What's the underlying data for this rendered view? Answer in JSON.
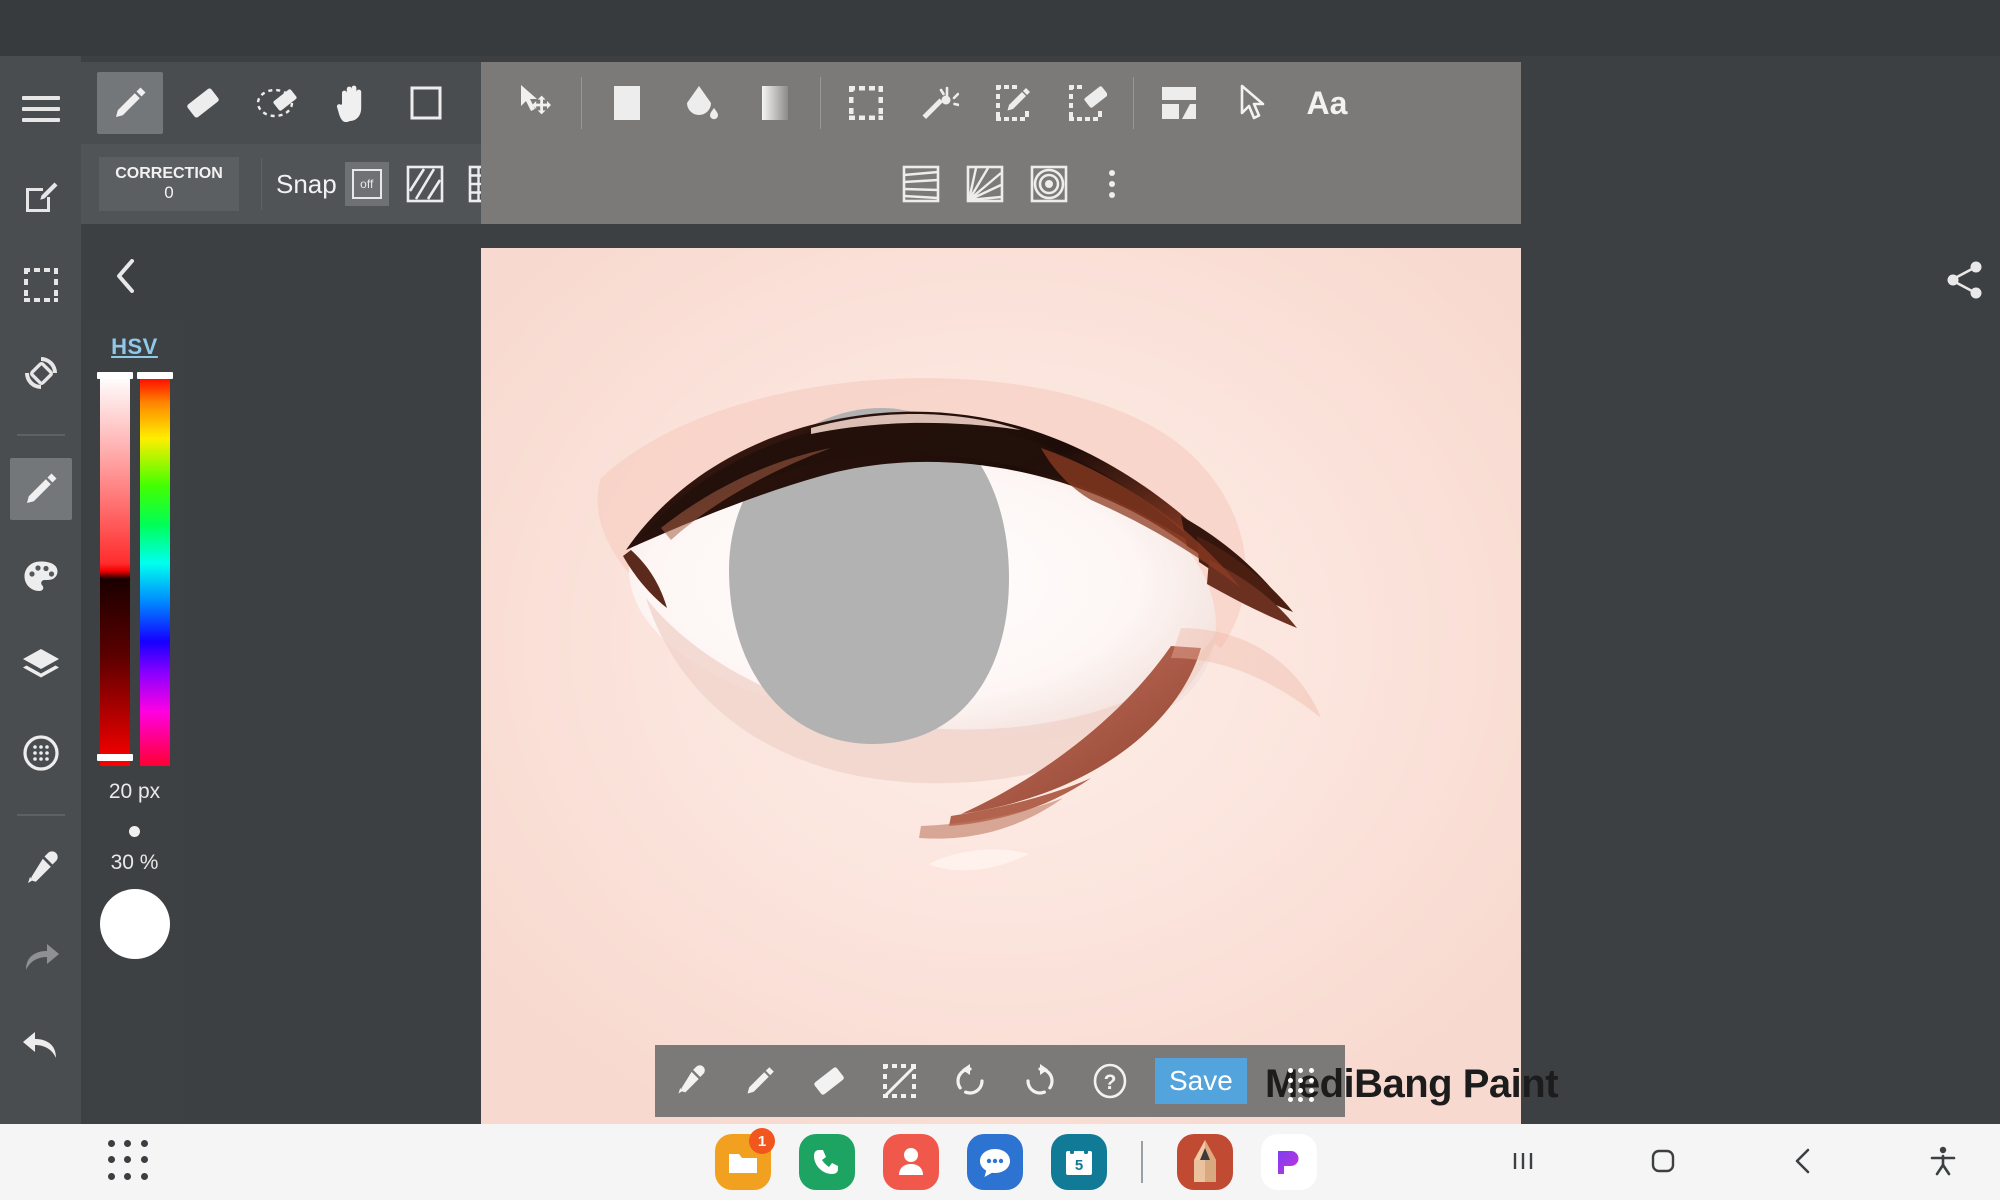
{
  "app": {
    "title": "MediBang Paint"
  },
  "sidebar": {
    "items": [
      {
        "name": "menu",
        "icon": "hamburger-menu-icon",
        "active": false,
        "dim": false
      },
      {
        "name": "new-canvas",
        "icon": "edit-square-icon",
        "active": false,
        "dim": false
      },
      {
        "name": "selection",
        "icon": "dashed-select-icon",
        "active": false,
        "dim": false
      },
      {
        "name": "rotate-canvas",
        "icon": "rotate-icon",
        "active": false,
        "dim": false
      },
      {
        "name": "brush",
        "icon": "pencil-icon",
        "active": true,
        "dim": false
      },
      {
        "name": "color-palette",
        "icon": "palette-icon",
        "active": false,
        "dim": false
      },
      {
        "name": "layers",
        "icon": "layers-icon",
        "active": false,
        "dim": false
      },
      {
        "name": "materials",
        "icon": "material-dots-icon",
        "active": false,
        "dim": false
      },
      {
        "name": "eyedropper",
        "icon": "eyedropper-icon",
        "active": false,
        "dim": false
      },
      {
        "name": "redo",
        "icon": "redo-arrow-icon",
        "active": false,
        "dim": true
      },
      {
        "name": "undo",
        "icon": "undo-arrow-icon",
        "active": false,
        "dim": false
      }
    ]
  },
  "toolbar_primary": {
    "tools": [
      {
        "name": "pen-tool",
        "icon": "pencil-icon",
        "active": true
      },
      {
        "name": "eraser-tool",
        "icon": "eraser-icon",
        "active": false
      },
      {
        "name": "selection-eraser-tool",
        "icon": "dashed-eraser-icon",
        "active": false
      },
      {
        "name": "hand-tool",
        "icon": "hand-icon",
        "active": false
      },
      {
        "name": "canvas-frame-tool",
        "icon": "rectangle-outline-icon",
        "active": false
      },
      {
        "name": "move-tool",
        "icon": "cursor-move-icon",
        "active": false
      },
      {
        "name": "fill-solid-tool",
        "icon": "solid-square-icon",
        "active": false
      },
      {
        "name": "bucket-tool",
        "icon": "paint-bucket-icon",
        "active": false
      },
      {
        "name": "gradient-tool",
        "icon": "gradient-square-icon",
        "active": false
      },
      {
        "name": "marquee-select-tool",
        "icon": "dashed-rectangle-icon",
        "active": false
      },
      {
        "name": "magic-wand-tool",
        "icon": "magic-wand-icon",
        "active": false
      },
      {
        "name": "select-pen-tool",
        "icon": "dashed-pen-icon",
        "active": false
      },
      {
        "name": "select-eraser-tool",
        "icon": "dashed-eraser-square-icon",
        "active": false
      },
      {
        "name": "divide-panel-tool",
        "icon": "panel-divide-icon",
        "active": false
      },
      {
        "name": "operation-tool",
        "icon": "arrow-cursor-icon",
        "active": false
      },
      {
        "name": "text-tool",
        "icon": "text-aa-icon",
        "active": false
      }
    ],
    "text_tool_label": "Aa"
  },
  "toolbar_options": {
    "correction_label": "CORRECTION",
    "correction_value": "0",
    "snap_label": "Snap",
    "snap_state": "off",
    "snap_modes": [
      {
        "name": "snap-parallel",
        "icon": "parallel-lines-icon",
        "active": false
      },
      {
        "name": "snap-grid",
        "icon": "grid-icon",
        "active": false
      },
      {
        "name": "snap-perspective-2pt",
        "icon": "perspective-lines-icon",
        "active": false
      },
      {
        "name": "snap-radial",
        "icon": "radial-lines-icon",
        "active": false
      },
      {
        "name": "snap-concentric",
        "icon": "concentric-circles-icon",
        "active": false
      }
    ],
    "more_label": "more-options"
  },
  "color_panel": {
    "mode_label": "HSV",
    "collapse_label": "collapse-panel",
    "brush_size": "20 px",
    "opacity": "30 %",
    "current_color": "#ffffff",
    "sv_handle_top_pct": 0,
    "sv_handle_bottom_pct": 96,
    "hue_handle_pct": 0
  },
  "canvas": {
    "background_color": "#fce9e3",
    "artwork_name": "anime-eye-drawing"
  },
  "float_toolbar": {
    "buttons": [
      {
        "name": "eyedropper-button",
        "icon": "eyedropper-icon"
      },
      {
        "name": "brush-button",
        "icon": "pencil-icon"
      },
      {
        "name": "eraser-button",
        "icon": "eraser-icon"
      },
      {
        "name": "deselect-button",
        "icon": "deselect-icon"
      },
      {
        "name": "undo-button",
        "icon": "undo-circular-icon"
      },
      {
        "name": "redo-button",
        "icon": "redo-circular-icon"
      },
      {
        "name": "help-button",
        "icon": "question-mark-circle-icon"
      }
    ],
    "save_label": "Save",
    "save_color": "#53a3dd"
  },
  "share": {
    "label": "share-icon"
  },
  "taskbar": {
    "apps_grid_label": "app-drawer",
    "apps": [
      {
        "name": "my-files",
        "icon": "folder-icon",
        "color": "#f2a020",
        "badge": "1"
      },
      {
        "name": "phone",
        "icon": "phone-icon",
        "color": "#1da462",
        "badge": ""
      },
      {
        "name": "contacts",
        "icon": "person-icon",
        "color": "#f0584b",
        "badge": ""
      },
      {
        "name": "messages",
        "icon": "chat-bubble-icon",
        "color": "#2c73d2",
        "badge": ""
      },
      {
        "name": "calendar",
        "icon": "calendar-icon",
        "color": "#117a96",
        "badge": "",
        "day": "5"
      },
      {
        "name": "medibang-paint",
        "icon": "pencil-app-icon",
        "color": "#c14a33",
        "badge": ""
      },
      {
        "name": "pinterest-like",
        "icon": "p-logo-icon",
        "color": "#ffffff",
        "badge": ""
      }
    ],
    "nav": [
      {
        "name": "recents-button",
        "icon": "recents-bars-icon"
      },
      {
        "name": "home-button",
        "icon": "home-square-icon"
      },
      {
        "name": "back-button",
        "icon": "back-chevron-icon"
      },
      {
        "name": "accessibility-button",
        "icon": "accessibility-person-icon"
      }
    ]
  }
}
